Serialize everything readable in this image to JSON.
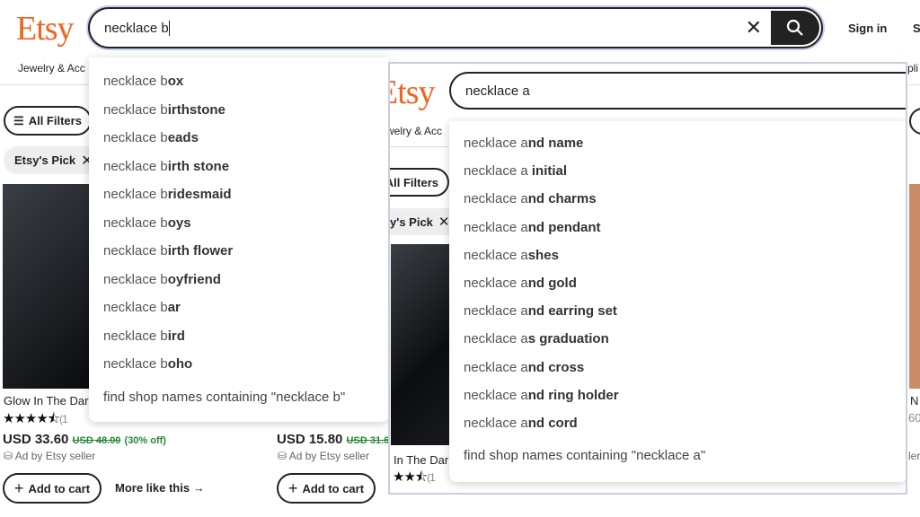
{
  "back": {
    "logo": "Etsy",
    "search_value": "necklace b",
    "sign_in": "Sign in",
    "right_cut": "S",
    "nav_item": "Jewelry & Acc",
    "all_filters": "All Filters",
    "chip": "Etsy's Pick",
    "suggestions": [
      {
        "p": "necklace b",
        "s": "ox"
      },
      {
        "p": "necklace b",
        "s": "irthstone"
      },
      {
        "p": "necklace b",
        "s": "eads"
      },
      {
        "p": "necklace b",
        "s": "irth stone"
      },
      {
        "p": "necklace b",
        "s": "ridesmaid"
      },
      {
        "p": "necklace b",
        "s": "oys"
      },
      {
        "p": "necklace b",
        "s": "irth flower"
      },
      {
        "p": "necklace b",
        "s": "oyfriend"
      },
      {
        "p": "necklace b",
        "s": "ar"
      },
      {
        "p": "necklace b",
        "s": "ird"
      },
      {
        "p": "necklace b",
        "s": "oho"
      }
    ],
    "find_shop": "find shop names containing \"necklace b\"",
    "products": [
      {
        "title": "Glow In The Dar",
        "stars": "★★★★⯪",
        "reviews": "(1",
        "price": "USD 33.60",
        "old": "USD 48.00",
        "off": "(30% off)",
        "ad": "Ad by Etsy seller",
        "cart": "Add to cart",
        "more": "More like this"
      },
      {
        "price": "USD 15.80",
        "old": "USD 31.6",
        "ad": "Ad by Etsy seller",
        "cart": "Add to cart"
      }
    ]
  },
  "front": {
    "logo": "Etsy",
    "search_value": "necklace a",
    "nav_item": "welry & Acc",
    "all_filters": "All Filters",
    "chip": "y's Pick",
    "suggestions": [
      {
        "p": "necklace a",
        "s": "nd name"
      },
      {
        "p": "necklace a ",
        "s": "initial"
      },
      {
        "p": "necklace a",
        "s": "nd charms"
      },
      {
        "p": "necklace a",
        "s": "nd pendant"
      },
      {
        "p": "necklace a",
        "s": "shes"
      },
      {
        "p": "necklace a",
        "s": "nd gold"
      },
      {
        "p": "necklace a",
        "s": "nd earring set"
      },
      {
        "p": "necklace a",
        "s": "s graduation"
      },
      {
        "p": "necklace a",
        "s": "nd cross"
      },
      {
        "p": "necklace a",
        "s": "nd ring holder"
      },
      {
        "p": "necklace a",
        "s": "nd cord"
      }
    ],
    "find_shop": "find shop names containing \"necklace a\"",
    "product_title": "In The Dar",
    "product_stars": "★★⯪",
    "product_reviews": "(1",
    "right_cut": {
      "nav": "pli",
      "title": "N",
      "price": "60",
      "ad": "ler"
    }
  },
  "colors": {
    "brand": "#f1641e",
    "discount": "#258635",
    "focus_ring": "#4d6bc6"
  }
}
